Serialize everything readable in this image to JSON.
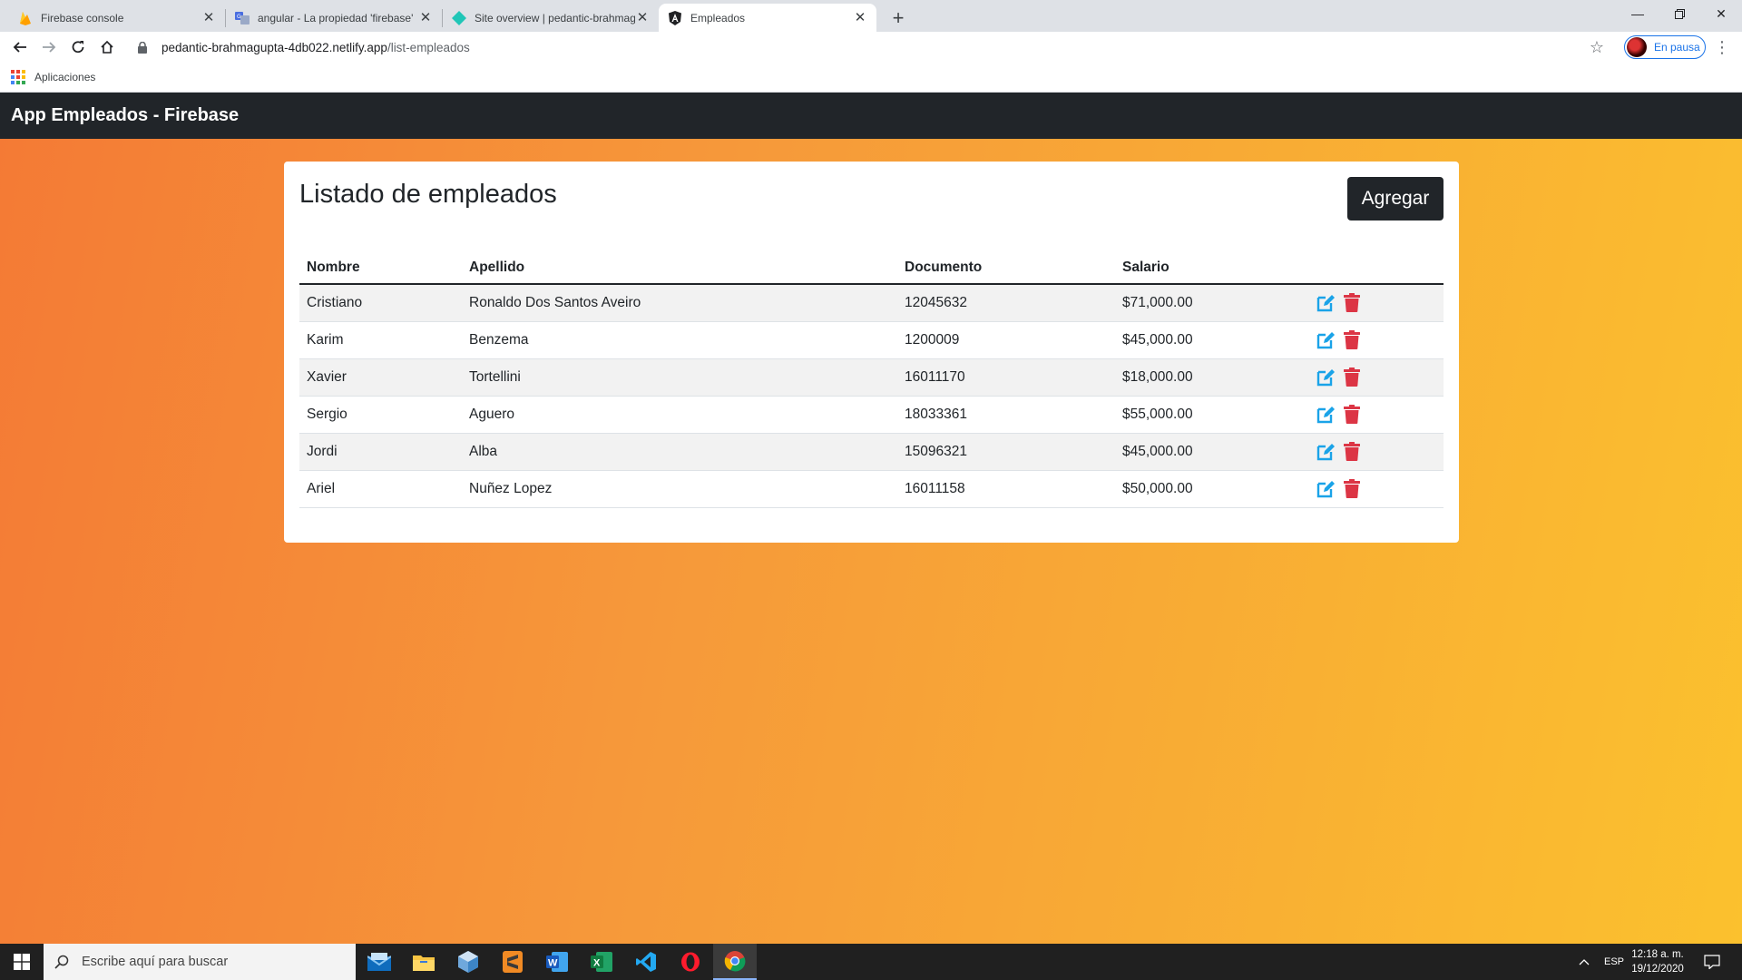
{
  "browser": {
    "tabs": [
      {
        "title": "Firebase console",
        "icon": "firebase-icon"
      },
      {
        "title": "angular - La propiedad 'firebase'",
        "icon": "translate-icon"
      },
      {
        "title": "Site overview | pedantic-brahmag",
        "icon": "netlify-icon"
      },
      {
        "title": "Empleados",
        "icon": "angular-icon"
      }
    ],
    "url_host": "pedantic-brahmagupta-4db022.netlify.app",
    "url_path": "/list-empleados",
    "profile_label": "En pausa",
    "bookmark_apps": "Aplicaciones"
  },
  "app": {
    "brand": "App Empleados - Firebase",
    "card_title": "Listado de empleados",
    "add_label": "Agregar",
    "columns": [
      "Nombre",
      "Apellido",
      "Documento",
      "Salario"
    ],
    "rows": [
      [
        "Cristiano",
        "Ronaldo Dos Santos Aveiro",
        "12045632",
        "$71,000.00"
      ],
      [
        "Karim",
        "Benzema",
        "1200009",
        "$45,000.00"
      ],
      [
        "Xavier",
        "Tortellini",
        "16011170",
        "$18,000.00"
      ],
      [
        "Sergio",
        "Aguero",
        "18033361",
        "$55,000.00"
      ],
      [
        "Jordi",
        "Alba",
        "15096321",
        "$45,000.00"
      ],
      [
        "Ariel",
        "Nuñez Lopez",
        "16011158",
        "$50,000.00"
      ]
    ],
    "colors": {
      "navbar": "#212529",
      "edit": "#1aa3e8",
      "delete": "#dc3545"
    }
  },
  "taskbar": {
    "search_placeholder": "Escribe aquí para buscar",
    "language": "ESP",
    "time": "12:18 a. m.",
    "date": "19/12/2020"
  }
}
